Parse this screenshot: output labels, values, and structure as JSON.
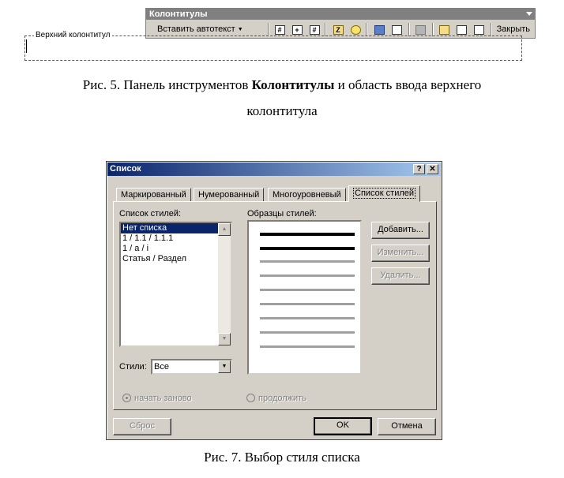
{
  "header_footer_toolbar": {
    "title": "Колонтитулы",
    "autotext_button": "Вставить автотекст",
    "close_button": "Закрыть"
  },
  "header_area": {
    "label": "Верхний колонтитул"
  },
  "caption_fig5": {
    "prefix": "Рис. 5. Панель инструментов ",
    "bold": "Колонтитулы",
    "suffix_line1": " и область ввода верхнего",
    "line2": "колонтитула"
  },
  "dialog": {
    "title": "Список",
    "help_button": "?",
    "close_button": "✕",
    "tabs": [
      "Маркированный",
      "Нумерованный",
      "Многоуровневый",
      "Список стилей"
    ],
    "active_tab": "Список стилей",
    "style_list_label": "Список стилей:",
    "style_list_items": [
      "Нет списка",
      "1 / 1.1 / 1.1.1",
      "1 / a / i",
      "Статья / Раздел"
    ],
    "selected_style": "Нет списка",
    "preview_label": "Образцы стилей:",
    "add_button": "Добавить...",
    "modify_button": "Изменить...",
    "delete_button": "Удалить...",
    "styles_label": "Стили:",
    "styles_value": "Все",
    "restart_radio": "начать заново",
    "continue_radio": "продолжить",
    "reset_button": "Сброс",
    "ok_button": "OK",
    "cancel_button": "Отмена"
  },
  "caption_fig7": "Рис. 7. Выбор стиля списка"
}
